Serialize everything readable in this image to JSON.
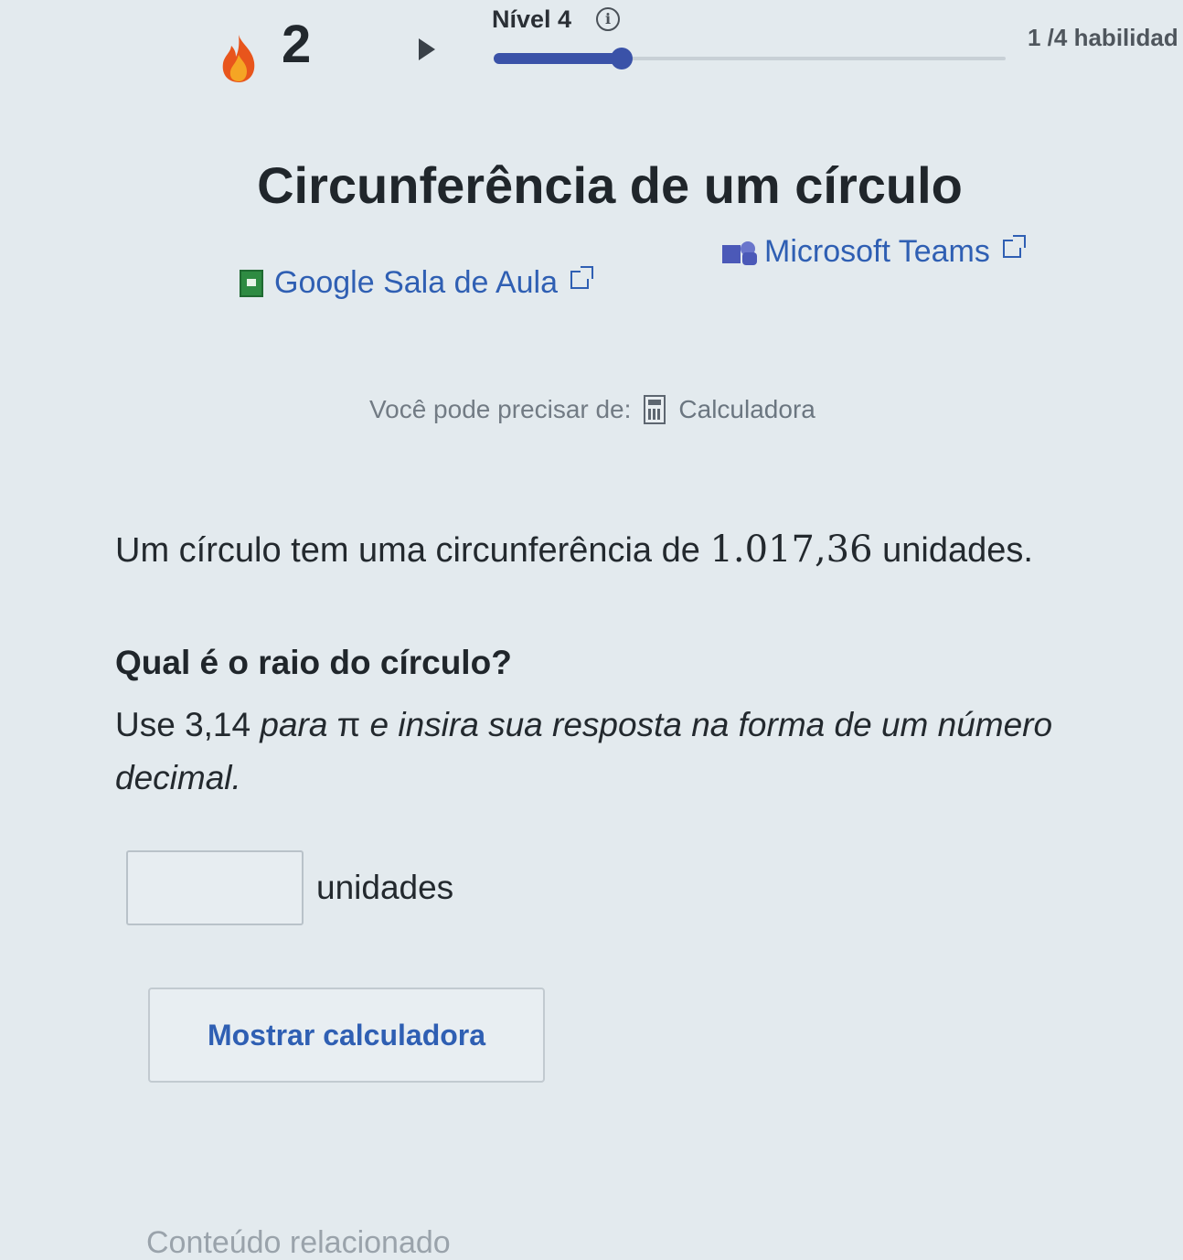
{
  "header": {
    "streak_count": "2",
    "level_label": "Nível 4",
    "info_glyph": "i",
    "skills_label": "1 /4 habilidad",
    "progress_fraction": 0.25,
    "accent_color": "#3a52a8",
    "streak_icon": "fire-icon"
  },
  "lesson": {
    "title": "Circunferência de um círculo"
  },
  "share": {
    "classroom_label": "Google Sala de Aula",
    "teams_label": "Microsoft Teams"
  },
  "tools": {
    "hint_prefix": "Você pode precisar de:",
    "calculator_label": "Calculadora"
  },
  "question": {
    "statement_before": "Um círculo tem uma circunferência de ",
    "circumference_value": "1.017,36",
    "statement_after": " unidades.",
    "prompt": "Qual é o raio do círculo?",
    "instruction_before": "Use ",
    "pi_value": "3,14",
    "instruction_middle": " para ",
    "pi_symbol": "π",
    "instruction_after": " e insira sua resposta na forma de um número decimal."
  },
  "answer": {
    "value": "",
    "placeholder": "",
    "unit_label": "unidades"
  },
  "actions": {
    "show_calculator_label": "Mostrar calculadora"
  },
  "footer": {
    "related_label": "Conteúdo relacionado"
  }
}
